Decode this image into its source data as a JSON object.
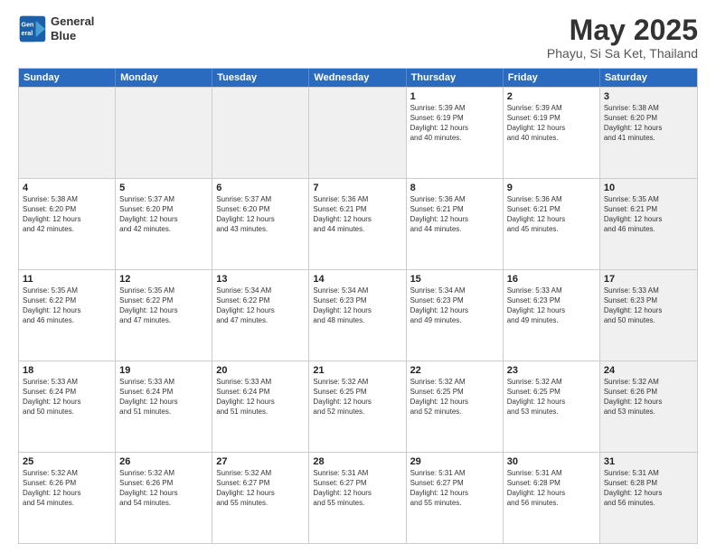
{
  "logo": {
    "line1": "General",
    "line2": "Blue"
  },
  "title": "May 2025",
  "subtitle": "Phayu, Si Sa Ket, Thailand",
  "header_days": [
    "Sunday",
    "Monday",
    "Tuesday",
    "Wednesday",
    "Thursday",
    "Friday",
    "Saturday"
  ],
  "rows": [
    [
      {
        "day": "",
        "info": "",
        "shaded": true
      },
      {
        "day": "",
        "info": "",
        "shaded": true
      },
      {
        "day": "",
        "info": "",
        "shaded": true
      },
      {
        "day": "",
        "info": "",
        "shaded": true
      },
      {
        "day": "1",
        "info": "Sunrise: 5:39 AM\nSunset: 6:19 PM\nDaylight: 12 hours\nand 40 minutes.",
        "shaded": false
      },
      {
        "day": "2",
        "info": "Sunrise: 5:39 AM\nSunset: 6:19 PM\nDaylight: 12 hours\nand 40 minutes.",
        "shaded": false
      },
      {
        "day": "3",
        "info": "Sunrise: 5:38 AM\nSunset: 6:20 PM\nDaylight: 12 hours\nand 41 minutes.",
        "shaded": true
      }
    ],
    [
      {
        "day": "4",
        "info": "Sunrise: 5:38 AM\nSunset: 6:20 PM\nDaylight: 12 hours\nand 42 minutes.",
        "shaded": false
      },
      {
        "day": "5",
        "info": "Sunrise: 5:37 AM\nSunset: 6:20 PM\nDaylight: 12 hours\nand 42 minutes.",
        "shaded": false
      },
      {
        "day": "6",
        "info": "Sunrise: 5:37 AM\nSunset: 6:20 PM\nDaylight: 12 hours\nand 43 minutes.",
        "shaded": false
      },
      {
        "day": "7",
        "info": "Sunrise: 5:36 AM\nSunset: 6:21 PM\nDaylight: 12 hours\nand 44 minutes.",
        "shaded": false
      },
      {
        "day": "8",
        "info": "Sunrise: 5:36 AM\nSunset: 6:21 PM\nDaylight: 12 hours\nand 44 minutes.",
        "shaded": false
      },
      {
        "day": "9",
        "info": "Sunrise: 5:36 AM\nSunset: 6:21 PM\nDaylight: 12 hours\nand 45 minutes.",
        "shaded": false
      },
      {
        "day": "10",
        "info": "Sunrise: 5:35 AM\nSunset: 6:21 PM\nDaylight: 12 hours\nand 46 minutes.",
        "shaded": true
      }
    ],
    [
      {
        "day": "11",
        "info": "Sunrise: 5:35 AM\nSunset: 6:22 PM\nDaylight: 12 hours\nand 46 minutes.",
        "shaded": false
      },
      {
        "day": "12",
        "info": "Sunrise: 5:35 AM\nSunset: 6:22 PM\nDaylight: 12 hours\nand 47 minutes.",
        "shaded": false
      },
      {
        "day": "13",
        "info": "Sunrise: 5:34 AM\nSunset: 6:22 PM\nDaylight: 12 hours\nand 47 minutes.",
        "shaded": false
      },
      {
        "day": "14",
        "info": "Sunrise: 5:34 AM\nSunset: 6:23 PM\nDaylight: 12 hours\nand 48 minutes.",
        "shaded": false
      },
      {
        "day": "15",
        "info": "Sunrise: 5:34 AM\nSunset: 6:23 PM\nDaylight: 12 hours\nand 49 minutes.",
        "shaded": false
      },
      {
        "day": "16",
        "info": "Sunrise: 5:33 AM\nSunset: 6:23 PM\nDaylight: 12 hours\nand 49 minutes.",
        "shaded": false
      },
      {
        "day": "17",
        "info": "Sunrise: 5:33 AM\nSunset: 6:23 PM\nDaylight: 12 hours\nand 50 minutes.",
        "shaded": true
      }
    ],
    [
      {
        "day": "18",
        "info": "Sunrise: 5:33 AM\nSunset: 6:24 PM\nDaylight: 12 hours\nand 50 minutes.",
        "shaded": false
      },
      {
        "day": "19",
        "info": "Sunrise: 5:33 AM\nSunset: 6:24 PM\nDaylight: 12 hours\nand 51 minutes.",
        "shaded": false
      },
      {
        "day": "20",
        "info": "Sunrise: 5:33 AM\nSunset: 6:24 PM\nDaylight: 12 hours\nand 51 minutes.",
        "shaded": false
      },
      {
        "day": "21",
        "info": "Sunrise: 5:32 AM\nSunset: 6:25 PM\nDaylight: 12 hours\nand 52 minutes.",
        "shaded": false
      },
      {
        "day": "22",
        "info": "Sunrise: 5:32 AM\nSunset: 6:25 PM\nDaylight: 12 hours\nand 52 minutes.",
        "shaded": false
      },
      {
        "day": "23",
        "info": "Sunrise: 5:32 AM\nSunset: 6:25 PM\nDaylight: 12 hours\nand 53 minutes.",
        "shaded": false
      },
      {
        "day": "24",
        "info": "Sunrise: 5:32 AM\nSunset: 6:26 PM\nDaylight: 12 hours\nand 53 minutes.",
        "shaded": true
      }
    ],
    [
      {
        "day": "25",
        "info": "Sunrise: 5:32 AM\nSunset: 6:26 PM\nDaylight: 12 hours\nand 54 minutes.",
        "shaded": false
      },
      {
        "day": "26",
        "info": "Sunrise: 5:32 AM\nSunset: 6:26 PM\nDaylight: 12 hours\nand 54 minutes.",
        "shaded": false
      },
      {
        "day": "27",
        "info": "Sunrise: 5:32 AM\nSunset: 6:27 PM\nDaylight: 12 hours\nand 55 minutes.",
        "shaded": false
      },
      {
        "day": "28",
        "info": "Sunrise: 5:31 AM\nSunset: 6:27 PM\nDaylight: 12 hours\nand 55 minutes.",
        "shaded": false
      },
      {
        "day": "29",
        "info": "Sunrise: 5:31 AM\nSunset: 6:27 PM\nDaylight: 12 hours\nand 55 minutes.",
        "shaded": false
      },
      {
        "day": "30",
        "info": "Sunrise: 5:31 AM\nSunset: 6:28 PM\nDaylight: 12 hours\nand 56 minutes.",
        "shaded": false
      },
      {
        "day": "31",
        "info": "Sunrise: 5:31 AM\nSunset: 6:28 PM\nDaylight: 12 hours\nand 56 minutes.",
        "shaded": true
      }
    ]
  ]
}
